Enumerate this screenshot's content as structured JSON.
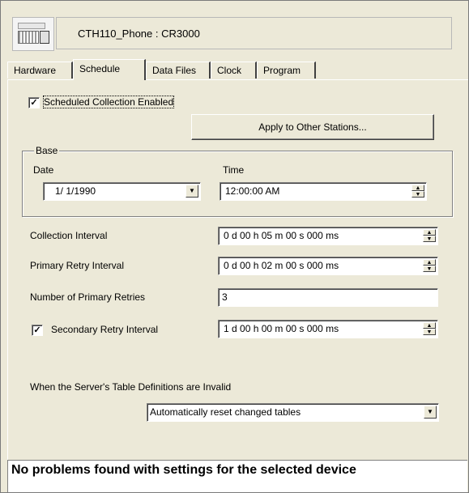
{
  "header": {
    "title": "CTH110_Phone : CR3000"
  },
  "tabs": [
    {
      "label": "Hardware",
      "active": false
    },
    {
      "label": "Schedule",
      "active": true
    },
    {
      "label": "Data Files",
      "active": false
    },
    {
      "label": "Clock",
      "active": false
    },
    {
      "label": "Program",
      "active": false
    }
  ],
  "schedule": {
    "scheduled_collection": {
      "label": "Scheduled Collection Enabled",
      "checked": true,
      "mark": "✓"
    },
    "apply_button": "Apply to Other Stations...",
    "base": {
      "legend": "Base",
      "date_label": "Date",
      "date_value": "1/ 1/1990",
      "time_label": "Time",
      "time_value": "12:00:00 AM"
    },
    "collection_interval": {
      "label": "Collection Interval",
      "value": "0 d 00 h 05 m 00 s 000 ms"
    },
    "primary_retry_interval": {
      "label": "Primary Retry Interval",
      "value": "0 d 00 h 02 m 00 s 000 ms"
    },
    "number_of_primary_retries": {
      "label": "Number of Primary Retries",
      "value": "3"
    },
    "secondary_retry_interval": {
      "label": "Secondary Retry Interval",
      "checked": true,
      "mark": "✓",
      "value": "1 d 00 h 00 m 00 s 000 ms"
    },
    "invalid_defs": {
      "label": "When the Server's Table Definitions are Invalid",
      "selected": "Automatically reset changed tables"
    }
  },
  "status": {
    "message": "No problems found with settings for the selected device"
  },
  "icons": {
    "spin_up": "▲",
    "spin_down": "▼",
    "dropdown": "▼"
  }
}
